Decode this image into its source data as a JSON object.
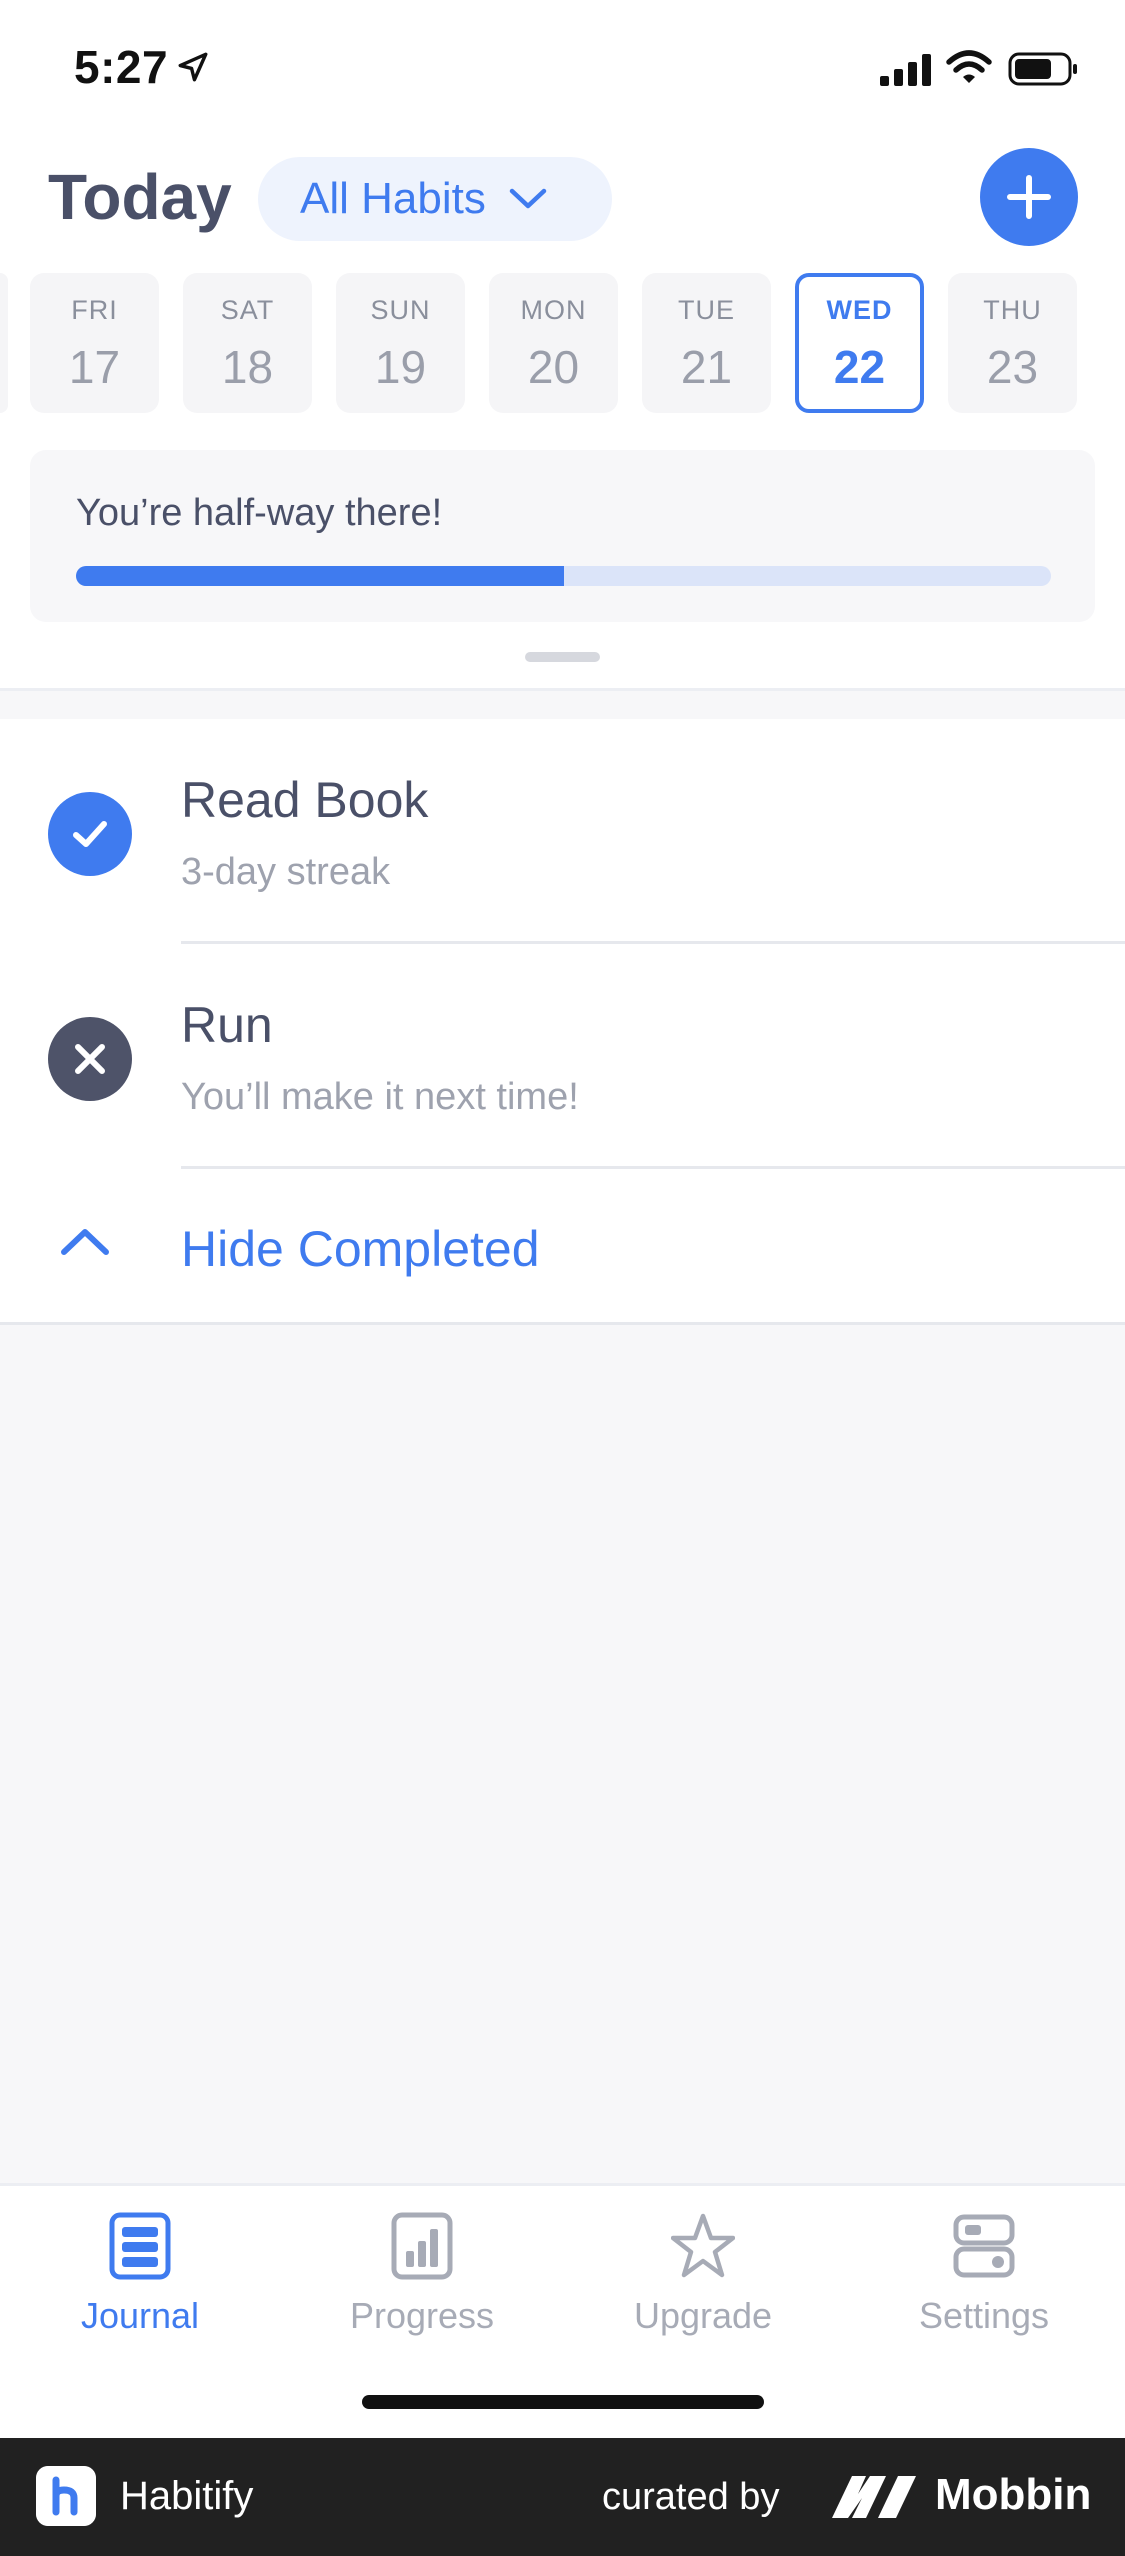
{
  "status_bar": {
    "time": "5:27"
  },
  "header": {
    "title": "Today",
    "filter_label": "All Habits"
  },
  "days": [
    {
      "dow": "FRI",
      "dom": "17",
      "selected": false
    },
    {
      "dow": "SAT",
      "dom": "18",
      "selected": false
    },
    {
      "dow": "SUN",
      "dom": "19",
      "selected": false
    },
    {
      "dow": "MON",
      "dom": "20",
      "selected": false
    },
    {
      "dow": "TUE",
      "dom": "21",
      "selected": false
    },
    {
      "dow": "WED",
      "dom": "22",
      "selected": true
    },
    {
      "dow": "THU",
      "dom": "23",
      "selected": false
    }
  ],
  "progress": {
    "message": "You’re half-way there!",
    "fraction": 0.5
  },
  "habits": [
    {
      "name": "Read Book",
      "subtitle": "3-day streak",
      "status": "completed",
      "icon": "check-icon"
    },
    {
      "name": "Run",
      "subtitle": "You’ll make it next time!",
      "status": "failed",
      "icon": "close-icon"
    }
  ],
  "hide_completed_label": "Hide Completed",
  "tabs": [
    {
      "label": "Journal",
      "icon": "journal-icon",
      "active": true
    },
    {
      "label": "Progress",
      "icon": "progress-icon",
      "active": false
    },
    {
      "label": "Upgrade",
      "icon": "star-icon",
      "active": false
    },
    {
      "label": "Settings",
      "icon": "settings-icon",
      "active": false
    }
  ],
  "banner": {
    "app_name": "Habitify",
    "curated": "curated by",
    "brand": "Mobbin"
  },
  "colors": {
    "accent": "#3f7bef",
    "failed": "#4e5369",
    "text": "#4a5068",
    "muted": "#9ea2ae"
  }
}
